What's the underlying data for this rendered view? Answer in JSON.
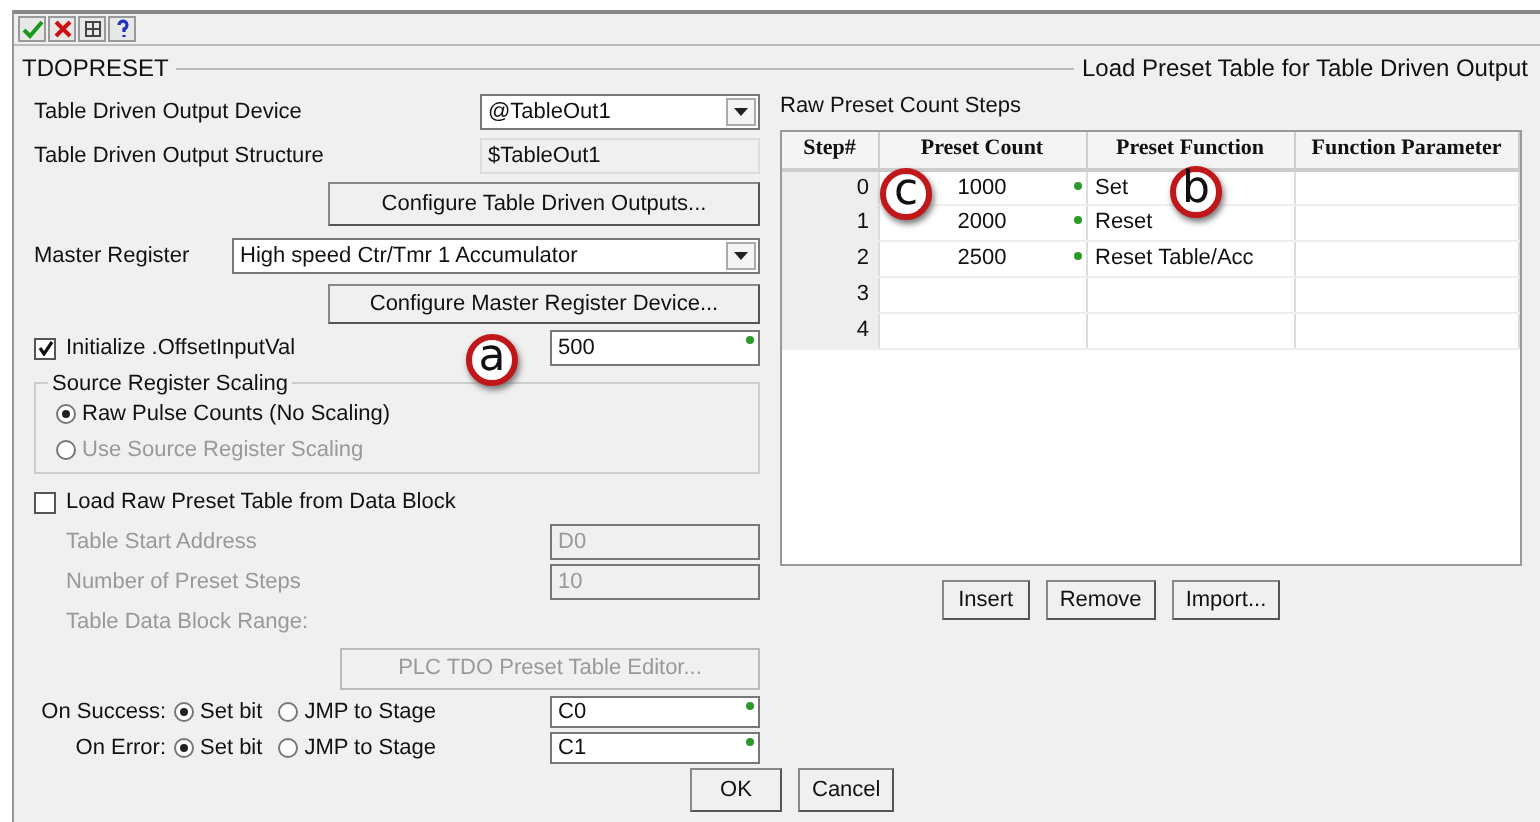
{
  "window": {
    "title": "TDOPRESET",
    "subtitle": "Load Preset Table for Table Driven Output"
  },
  "left": {
    "device": {
      "label": "Table Driven Output Device",
      "value": "@TableOut1"
    },
    "structure": {
      "label": "Table Driven Output Structure",
      "value": "$TableOut1"
    },
    "configure_outputs_button": "Configure Table Driven Outputs...",
    "master_register": {
      "label": "Master Register",
      "value": "High speed Ctr/Tmr 1 Accumulator"
    },
    "configure_master_button": "Configure Master Register Device...",
    "initialize": {
      "label": "Initialize .OffsetInputVal",
      "checked": true,
      "value": "500"
    },
    "scaling": {
      "title": "Source Register Scaling",
      "options": [
        {
          "label": "Raw Pulse Counts (No Scaling)",
          "selected": true,
          "disabled": false
        },
        {
          "label": "Use Source Register Scaling",
          "selected": false,
          "disabled": true
        }
      ]
    },
    "load_block": {
      "label": "Load Raw Preset Table from Data Block",
      "checked": false,
      "fields": [
        {
          "label": "Table Start Address",
          "value": "D0"
        },
        {
          "label": "Number of Preset Steps",
          "value": "10"
        },
        {
          "label": "Table Data Block Range:"
        }
      ],
      "editor_button": "PLC TDO Preset Table Editor..."
    },
    "outcomes": [
      {
        "label": "On Success:",
        "options": [
          {
            "label": "Set bit",
            "selected": true
          },
          {
            "label": "JMP to Stage",
            "selected": false
          }
        ],
        "value": "C0"
      },
      {
        "label": "On Error:",
        "options": [
          {
            "label": "Set bit",
            "selected": true
          },
          {
            "label": "JMP to Stage",
            "selected": false
          }
        ],
        "value": "C1"
      }
    ]
  },
  "right": {
    "title": "Raw Preset Count Steps",
    "columns": [
      "Step#",
      "Preset Count",
      "Preset Function",
      "Function Parameter"
    ],
    "rows": [
      {
        "step": "0",
        "count": "1000",
        "function": "Set"
      },
      {
        "step": "1",
        "count": "2000",
        "function": "Reset"
      },
      {
        "step": "2",
        "count": "2500",
        "function": "Reset Table/Acc"
      },
      {
        "step": "3"
      },
      {
        "step": "4"
      }
    ],
    "buttons": [
      "Insert",
      "Remove",
      "Import..."
    ]
  },
  "callouts": [
    "a",
    "b",
    "c"
  ],
  "buttons": [
    "OK",
    "Cancel"
  ]
}
